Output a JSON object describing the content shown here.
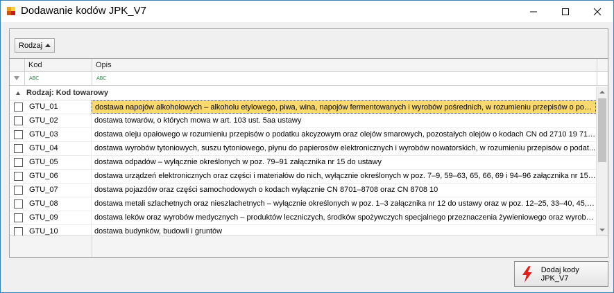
{
  "window": {
    "title": "Dodawanie kodów JPK_V7"
  },
  "group_panel": {
    "chip_label": "Rodzaj"
  },
  "grid": {
    "columns": [
      "Kod",
      "Opis"
    ],
    "filter_hint": "ABC",
    "group_label": "Rodzaj: Kod towarowy",
    "rows": [
      {
        "code": "GTU_01",
        "desc": "dostawa napojów alkoholowych – alkoholu etylowego, piwa, wina, napojów fermentowanych i wyrobów pośrednich, w rozumieniu przepisów o poda...",
        "selected": true
      },
      {
        "code": "GTU_02",
        "desc": "dostawa towarów, o których mowa w art. 103 ust. 5aa ustawy",
        "selected": false
      },
      {
        "code": "GTU_03",
        "desc": "dostawa oleju opałowego w rozumieniu przepisów o podatku akcyzowym oraz olejów smarowych, pozostałych olejów o kodach CN od 2710 19 71 d...",
        "selected": false
      },
      {
        "code": "GTU_04",
        "desc": "dostawa wyrobów tytoniowych, suszu tytoniowego, płynu do papierosów elektronicznych i wyrobów nowatorskich, w rozumieniu przepisów o podat...",
        "selected": false
      },
      {
        "code": "GTU_05",
        "desc": "dostawa odpadów – wyłącznie określonych w poz. 79–91 załącznika nr 15 do ustawy",
        "selected": false
      },
      {
        "code": "GTU_06",
        "desc": "dostawa urządzeń elektronicznych oraz części i materiałów do nich, wyłącznie określonych w poz. 7–9, 59–63, 65, 66, 69 i 94–96 załącznika nr 15 d...",
        "selected": false
      },
      {
        "code": "GTU_07",
        "desc": "dostawa pojazdów oraz części samochodowych o kodach wyłącznie CN 8701–8708 oraz CN 8708 10",
        "selected": false
      },
      {
        "code": "GTU_08",
        "desc": "dostawa metali szlachetnych oraz nieszlachetnych – wyłącznie określonych w poz. 1–3 załącznika nr 12 do ustawy oraz w poz. 12–25, 33–40, 45, 4...",
        "selected": false
      },
      {
        "code": "GTU_09",
        "desc": "dostawa leków oraz wyrobów medycznych – produktów leczniczych, środków spożywczych specjalnego przeznaczenia żywieniowego oraz wyrobów...",
        "selected": false
      },
      {
        "code": "GTU_10",
        "desc": "dostawa budynków, budowli i gruntów",
        "selected": false
      }
    ]
  },
  "actions": {
    "add_label": "Dodaj kody JPK_V7"
  },
  "colors": {
    "selection": "#fbd96d",
    "bolt": "#e0201a",
    "window_border": "#3c7fb1"
  }
}
